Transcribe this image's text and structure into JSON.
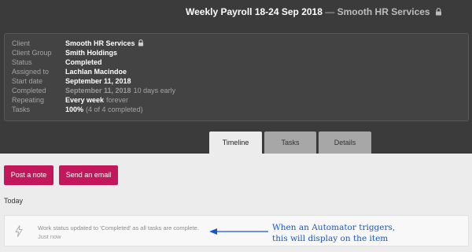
{
  "header": {
    "title": "Weekly Payroll 18-24 Sep 2018",
    "separator": " — ",
    "client": "Smooth HR Services"
  },
  "details": {
    "client": {
      "label": "Client",
      "value": "Smooth HR Services"
    },
    "client_group": {
      "label": "Client Group",
      "value": "Smith Holdings"
    },
    "status": {
      "label": "Status",
      "value": "Completed"
    },
    "assigned_to": {
      "label": "Assigned to",
      "value": "Lachlan Macindoe"
    },
    "start_date": {
      "label": "Start date",
      "value": "September 11, 2018"
    },
    "completed": {
      "label": "Completed",
      "value": "September 11, 2018",
      "note": "10 days early"
    },
    "repeating": {
      "label": "Repeating",
      "value": "Every week",
      "note": "forever"
    },
    "tasks": {
      "label": "Tasks",
      "value": "100%",
      "note": "(4 of 4 completed)"
    }
  },
  "tabs": [
    "Timeline",
    "Tasks",
    "Details"
  ],
  "active_tab": "Timeline",
  "actions": {
    "post_note": "Post a note",
    "send_email": "Send an email"
  },
  "timeline": {
    "group_label": "Today",
    "items": [
      {
        "icon": "lightning-bolt-icon",
        "message": "Work status updated to 'Completed' as all tasks are complete.",
        "time": "Just now"
      }
    ]
  },
  "annotation": {
    "line1": "When an Automator triggers,",
    "line2": "this will display on the item"
  },
  "colors": {
    "header_bg": "#3b3b3b",
    "primary_button": "#c2185b",
    "annotation": "#1a56c8"
  }
}
